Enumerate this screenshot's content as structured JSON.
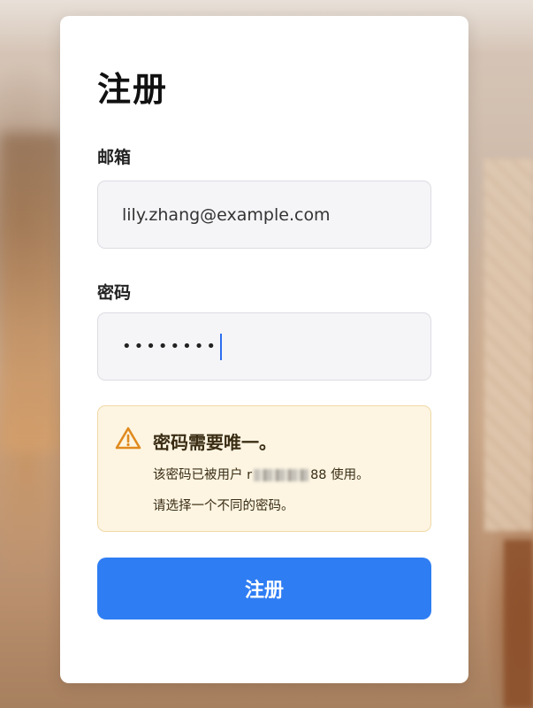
{
  "form": {
    "title": "注册",
    "email_label": "邮箱",
    "email_value": "lily.zhang@example.com",
    "password_label": "密码",
    "password_value": "••••••••",
    "submit_label": "注册"
  },
  "warning": {
    "icon": "warning-triangle-icon",
    "title": "密码需要唯一。",
    "line1_prefix": "该密码已被用户 r",
    "line1_suffix": "88 使用。",
    "line2": "请选择一个不同的密码。"
  },
  "colors": {
    "accent": "#2f7df3",
    "warning_bg": "#fdf5e2",
    "warning_icon": "#e08a1e"
  }
}
